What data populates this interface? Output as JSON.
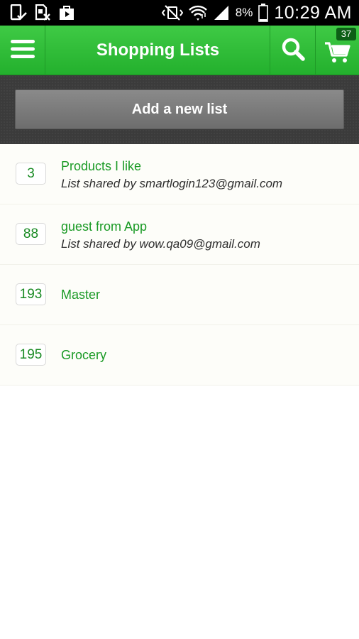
{
  "status_bar": {
    "battery_pct": "8%",
    "time": "10:29 AM"
  },
  "app_bar": {
    "title": "Shopping Lists",
    "cart_count": "37"
  },
  "add_list_button": "Add a new list",
  "lists": [
    {
      "count": "3",
      "name": "Products I like",
      "subtitle": "List shared by smartlogin123@gmail.com"
    },
    {
      "count": "88",
      "name": "guest from App",
      "subtitle": "List shared by wow.qa09@gmail.com"
    },
    {
      "count": "193",
      "name": "Master",
      "subtitle": ""
    },
    {
      "count": "195",
      "name": "Grocery",
      "subtitle": ""
    }
  ],
  "colors": {
    "brand_green": "#2dbb36",
    "list_text_green": "#1a9a25"
  }
}
